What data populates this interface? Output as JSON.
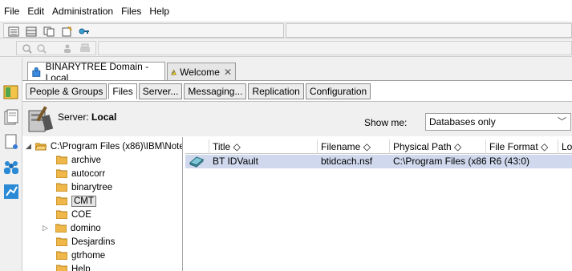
{
  "menu": [
    "File",
    "Edit",
    "Administration",
    "Files",
    "Help"
  ],
  "doc_tabs": [
    {
      "label": "BINARYTREE Domain - Local",
      "active": true
    },
    {
      "label": "Welcome",
      "active": false
    }
  ],
  "sub_tabs": [
    "People & Groups",
    "Files",
    "Server...",
    "Messaging...",
    "Replication",
    "Configuration"
  ],
  "server": {
    "label": "Server:",
    "name": "Local"
  },
  "show_me": {
    "label": "Show me:",
    "value": "Databases only"
  },
  "tree": {
    "root": "C:\\Program Files (x86)\\IBM\\Note",
    "items": [
      "archive",
      "autocorr",
      "binarytree",
      "CMT",
      "COE",
      "domino",
      "Desjardins",
      "gtrhome",
      "Help"
    ]
  },
  "grid": {
    "columns": [
      "Title",
      "Filename",
      "Physical Path",
      "File Format",
      "Lo"
    ],
    "sort_glyph": "◇",
    "rows": [
      {
        "title": "BT IDVault",
        "filename": "btidcach.nsf",
        "path": "C:\\Program Files (x86",
        "format": "R6 (43:0)"
      }
    ]
  },
  "colors": {
    "selection": "#cfd8ec",
    "folder": "#f0b84a"
  }
}
